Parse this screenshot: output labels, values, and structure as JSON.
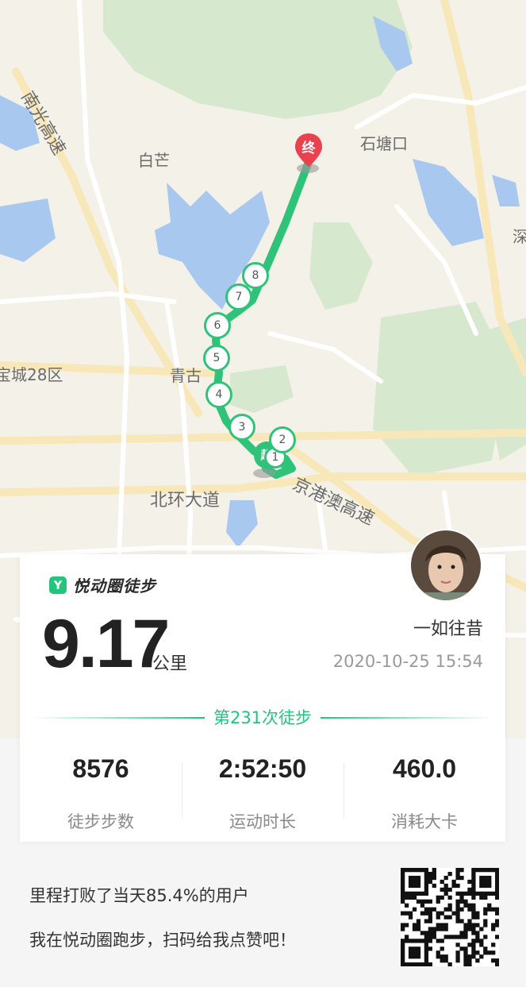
{
  "map": {
    "labels": {
      "nanguang": "南光高速",
      "baimang": "白芒",
      "shitangkou": "石塘口",
      "baocheng": "宝城28区",
      "qinggu": "青古",
      "beihuan": "北环大道",
      "gangao": "京港澳高速",
      "shen": "深"
    },
    "end_marker": "终",
    "start_marker": "起",
    "km_markers": [
      "1",
      "2",
      "3",
      "4",
      "5",
      "6",
      "7",
      "8"
    ],
    "route_color": "#2fc37a"
  },
  "card": {
    "brand_icon": "Y",
    "brand": "悦动圈徒步",
    "distance": "9.17",
    "unit": "公里",
    "username": "一如往昔",
    "datetime": "2020-10-25 15:54",
    "session": "第231次徒步",
    "stats": [
      {
        "value": "8576",
        "label": "徒步步数"
      },
      {
        "value": "2:52:50",
        "label": "运动时长"
      },
      {
        "value": "460.0",
        "label": "消耗大卡"
      }
    ]
  },
  "footer": {
    "line1": "里程打败了当天85.4%的用户",
    "line2": "我在悦动圈跑步，扫码给我点赞吧！"
  },
  "colors": {
    "accent": "#23c57d",
    "end_marker": "#e8424e"
  }
}
